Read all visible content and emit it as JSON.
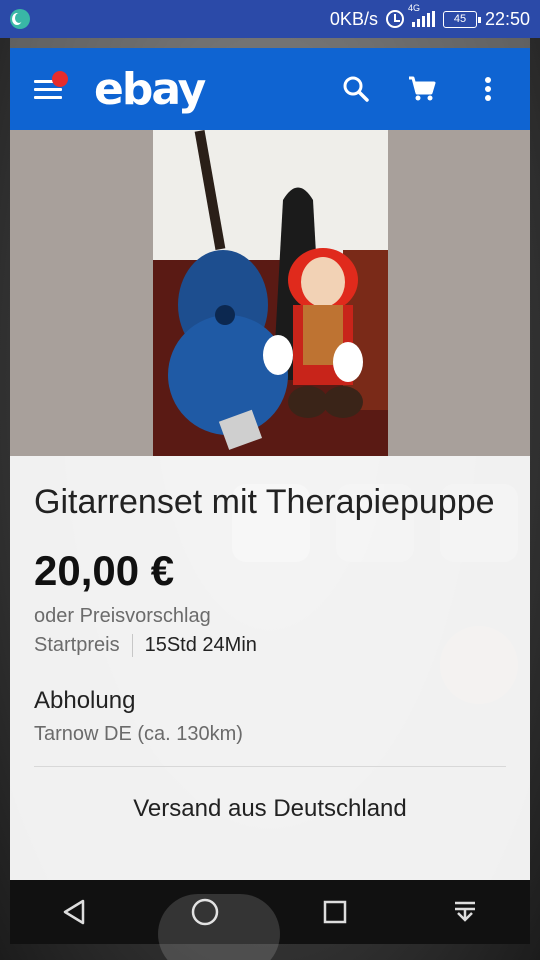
{
  "status_bar": {
    "net_speed": "0KB/s",
    "network_type": "4G",
    "battery": "45",
    "time": "22:50"
  },
  "app_bar": {
    "logo": "ebay"
  },
  "listing": {
    "title": "Gitarrenset mit Therapiepuppe",
    "price": "20,00 €",
    "offer_text": "oder Preisvorschlag",
    "start_label": "Startpreis",
    "time_left": "15Std 24Min",
    "delivery_method": "Abholung",
    "location": "Tarnow DE (ca. 130km)",
    "shipping": "Versand aus Deutschland"
  },
  "colors": {
    "ebay_blue": "#0f64d2",
    "status_bar": "#2b4aa8",
    "badge_red": "#e52c2c"
  }
}
